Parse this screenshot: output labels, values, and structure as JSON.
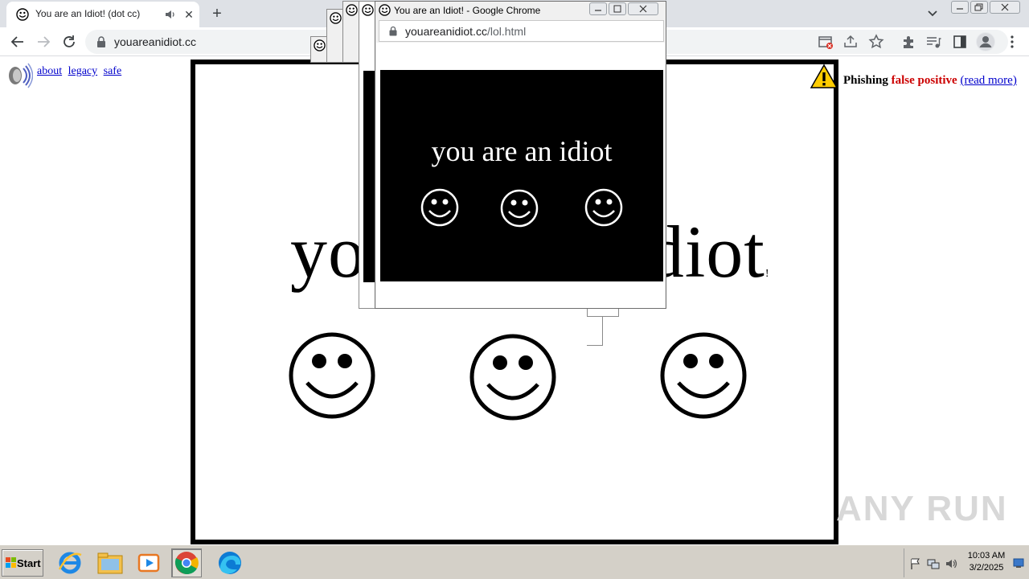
{
  "browser": {
    "tab_title": "You are an Idiot! (dot cc)",
    "tab_close": "✕",
    "new_tab": "+",
    "url": "youareanidiot.cc"
  },
  "page": {
    "links": [
      "about",
      "legacy",
      "safe"
    ],
    "big_text": "you are an idiot",
    "big_text_suffix": "!",
    "phishing": {
      "label": "Phishing",
      "status": "false positive",
      "read_more": "(read more)"
    },
    "watermark": "ANY RUN"
  },
  "popup": {
    "title": "You are an Idiot! - Google Chrome",
    "url_host": "youareanidiot.cc",
    "url_path": "/lol.html",
    "text": "you are an idiot"
  },
  "taskbar": {
    "start_label": "Start",
    "time": "10:03 AM",
    "date": "3/2/2025"
  },
  "colors": {
    "tabstrip": "#dee1e6",
    "taskbar": "#d4d0c8",
    "phishing_red": "#cc0000",
    "link_blue": "#0000cc"
  },
  "icons": [
    "smiley-favicon",
    "speaker-icon",
    "warning-icon",
    "lock-icon",
    "back-icon",
    "forward-icon",
    "reload-icon",
    "star-icon",
    "extensions-icon",
    "profile-icon",
    "menu-icon",
    "ie-icon",
    "explorer-icon",
    "media-icon",
    "chrome-icon",
    "edge-icon"
  ]
}
